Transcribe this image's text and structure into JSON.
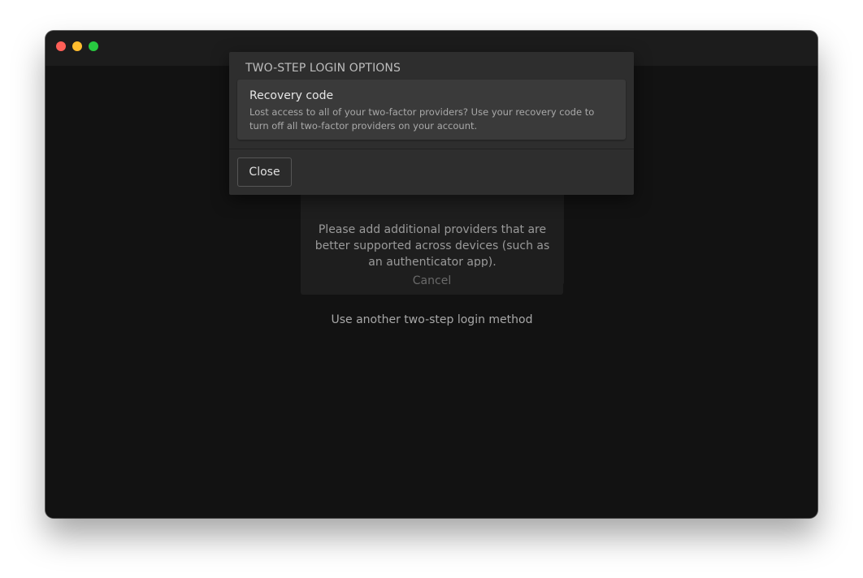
{
  "window": {
    "controls": [
      "close",
      "minimize",
      "maximize"
    ]
  },
  "main": {
    "info_text": "Please add additional providers that are better supported across devices (such as an authenticator app).",
    "cancel_label": "Cancel",
    "another_method_label": "Use another two-step login method"
  },
  "modal": {
    "title": "TWO-STEP LOGIN OPTIONS",
    "options": [
      {
        "title": "Recovery code",
        "description": "Lost access to all of your two-factor providers? Use your recovery code to turn off all two-factor providers on your account."
      }
    ],
    "close_label": "Close"
  },
  "colors": {
    "window_bg": "#121212",
    "modal_bg": "#2e2e2e",
    "card_bg": "#3a3a3a",
    "traffic_red": "#fe5f57",
    "traffic_yellow": "#febc2e",
    "traffic_green": "#28c840"
  }
}
